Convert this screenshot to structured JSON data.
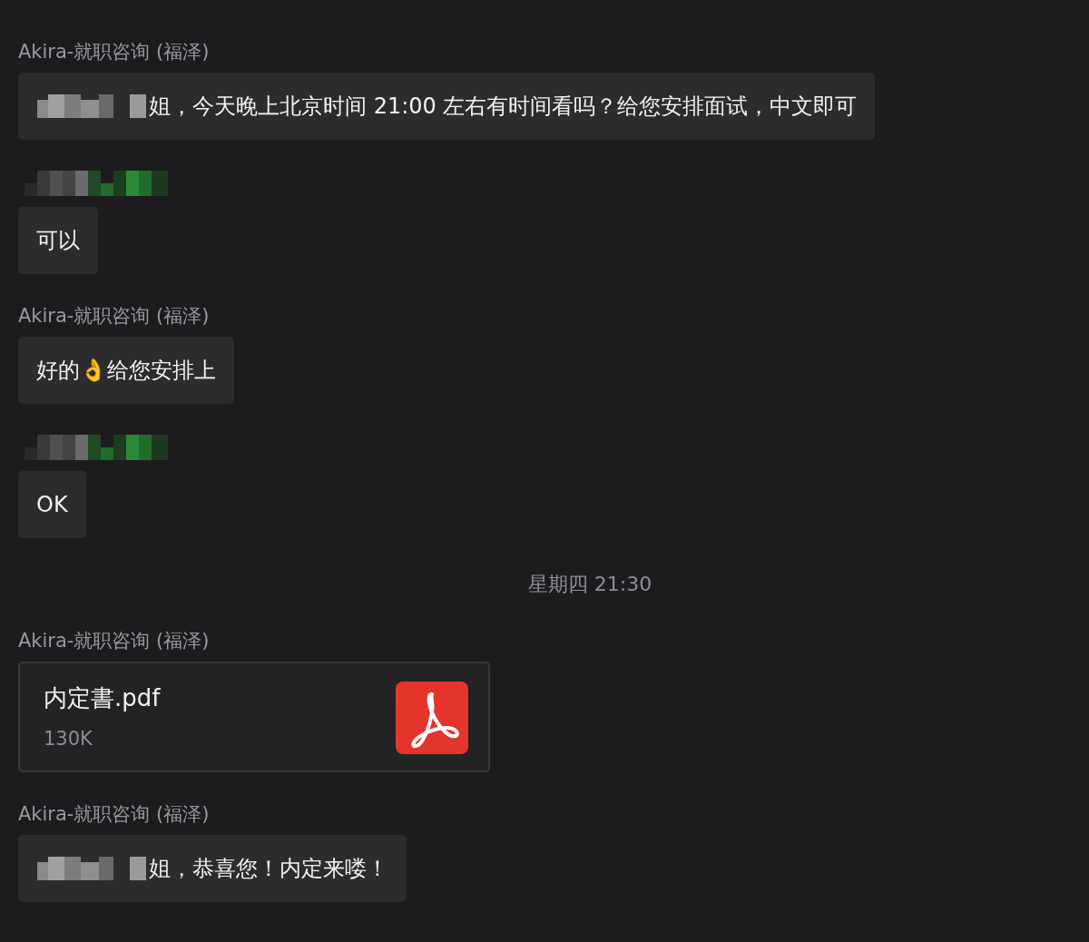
{
  "messages": [
    {
      "kind": "text",
      "sender": {
        "kind": "name",
        "text": "Akira-就职咨询 (福泽)"
      },
      "redacted_prefix": true,
      "text": "姐，今天晚上北京时间 21:00 左右有时间看吗？给您安排面试，中文即可"
    },
    {
      "kind": "text",
      "sender": {
        "kind": "redacted"
      },
      "redacted_prefix": false,
      "text": "可以"
    },
    {
      "kind": "text",
      "sender": {
        "kind": "name",
        "text": "Akira-就职咨询 (福泽)"
      },
      "redacted_prefix": false,
      "text": "好的👌给您安排上"
    },
    {
      "kind": "text",
      "sender": {
        "kind": "redacted"
      },
      "redacted_prefix": false,
      "text": "OK"
    },
    {
      "kind": "time",
      "text": "星期四 21:30"
    },
    {
      "kind": "file",
      "sender": {
        "kind": "name",
        "text": "Akira-就职咨询 (福泽)"
      },
      "file_name": "内定書.pdf",
      "size": "130K"
    },
    {
      "kind": "text",
      "sender": {
        "kind": "name",
        "text": "Akira-就职咨询 (福泽)"
      },
      "redacted_prefix": true,
      "text": "姐，恭喜您！内定来喽！"
    }
  ]
}
